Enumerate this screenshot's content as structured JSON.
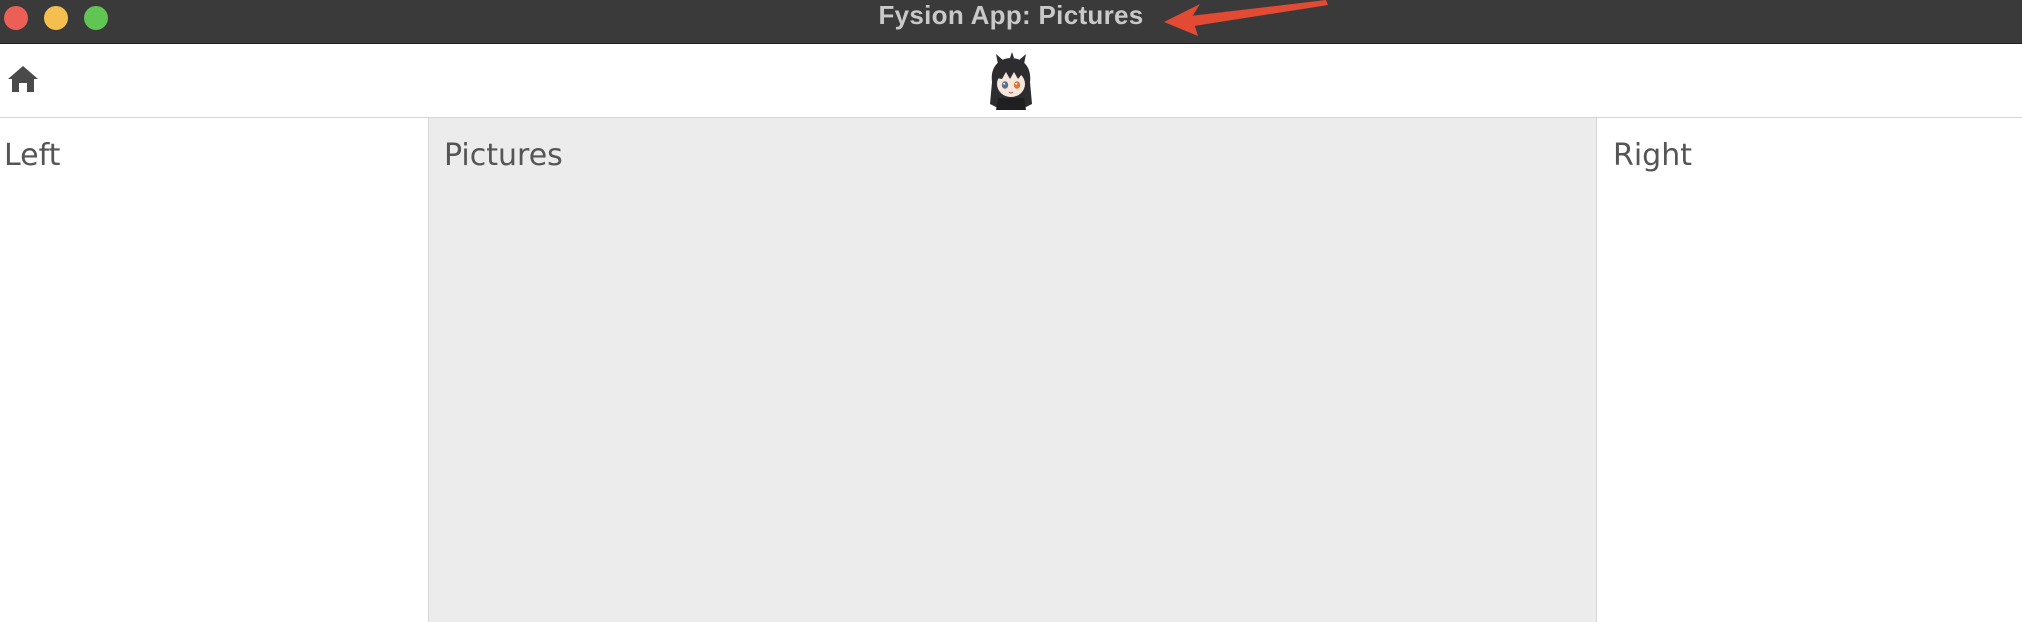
{
  "window": {
    "title": "Fysion App: Pictures",
    "traffic_lights": {
      "close_color": "#ec5f57",
      "minimize_color": "#f5bf4f",
      "maximize_color": "#61c554"
    },
    "annotation_arrow_color": "#e34a33"
  },
  "toolbar": {
    "home_icon": "home-icon",
    "avatar_icon": "anime-avatar-icon"
  },
  "panels": {
    "left": {
      "title": "Left"
    },
    "center": {
      "title": "Pictures"
    },
    "right": {
      "title": "Right"
    }
  }
}
